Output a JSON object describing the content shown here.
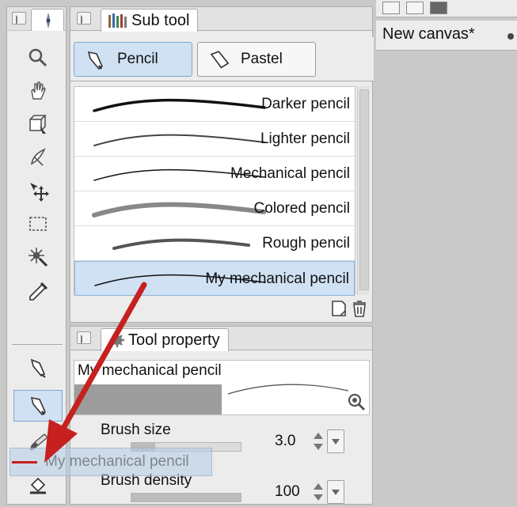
{
  "subtool_panel": {
    "title": "Sub tool",
    "groups": [
      {
        "label": "Pencil",
        "icon": "pencil-icon",
        "active": true
      },
      {
        "label": "Pastel",
        "icon": "pastel-icon",
        "active": false
      }
    ],
    "brushes": [
      {
        "label": "Darker pencil",
        "selected": false
      },
      {
        "label": "Lighter pencil",
        "selected": false
      },
      {
        "label": "Mechanical pencil",
        "selected": false
      },
      {
        "label": "Colored pencil",
        "selected": false
      },
      {
        "label": "Rough pencil",
        "selected": false
      },
      {
        "label": "My mechanical pencil",
        "selected": true
      }
    ]
  },
  "toolprop_panel": {
    "title": "Tool property",
    "preview_name": "My mechanical pencil",
    "props": [
      {
        "label": "Brush size",
        "value": "3.0"
      },
      {
        "label": "Brush density",
        "value": "100"
      }
    ]
  },
  "canvas": {
    "tab_label": "New canvas*"
  },
  "drag": {
    "ghost_label": "My mechanical pencil",
    "arrow_color": "#c62020"
  },
  "colors": {
    "selection": "#cfe1f3",
    "panel_bg": "#ececec",
    "canvas_bg": "#c9c9c9"
  }
}
